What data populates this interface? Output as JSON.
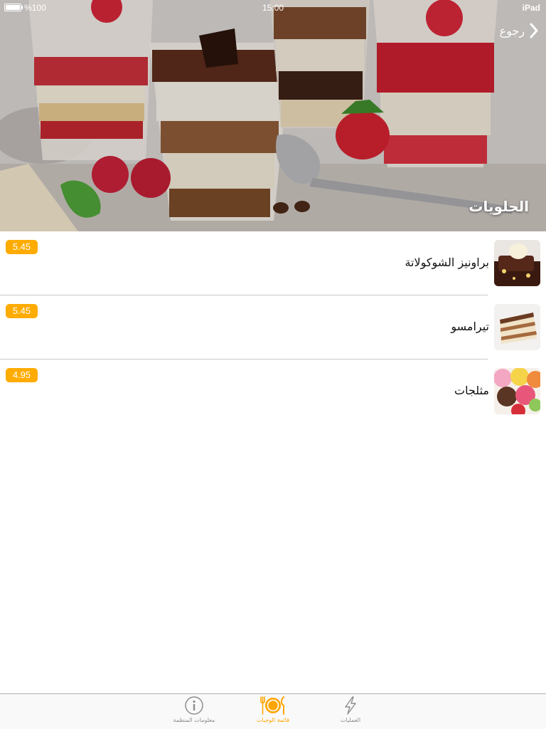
{
  "status_bar": {
    "battery": "%100",
    "time": "15:00",
    "device": "iPad"
  },
  "nav": {
    "back_label": "رجوع"
  },
  "header": {
    "title": "الحلويات"
  },
  "items": [
    {
      "name": "براونيز الشوكولاتة",
      "price": "5.45",
      "icon": "brownie-thumbnail"
    },
    {
      "name": "تيرامسو",
      "price": "5.45",
      "icon": "tiramisu-thumbnail"
    },
    {
      "name": "مثلجات",
      "price": "4.95",
      "icon": "ice-cream-thumbnail"
    }
  ],
  "tabs": [
    {
      "label": "معلومات المنظمة",
      "icon": "info-icon",
      "active": false
    },
    {
      "label": "قائمة الوجبات",
      "icon": "plate-cutlery-icon",
      "active": true
    },
    {
      "label": "العمليات",
      "icon": "lightning-icon",
      "active": false
    }
  ],
  "colors": {
    "accent": "#ffa500",
    "price_badge": "#ffab00",
    "separator": "#c8c7cc"
  }
}
